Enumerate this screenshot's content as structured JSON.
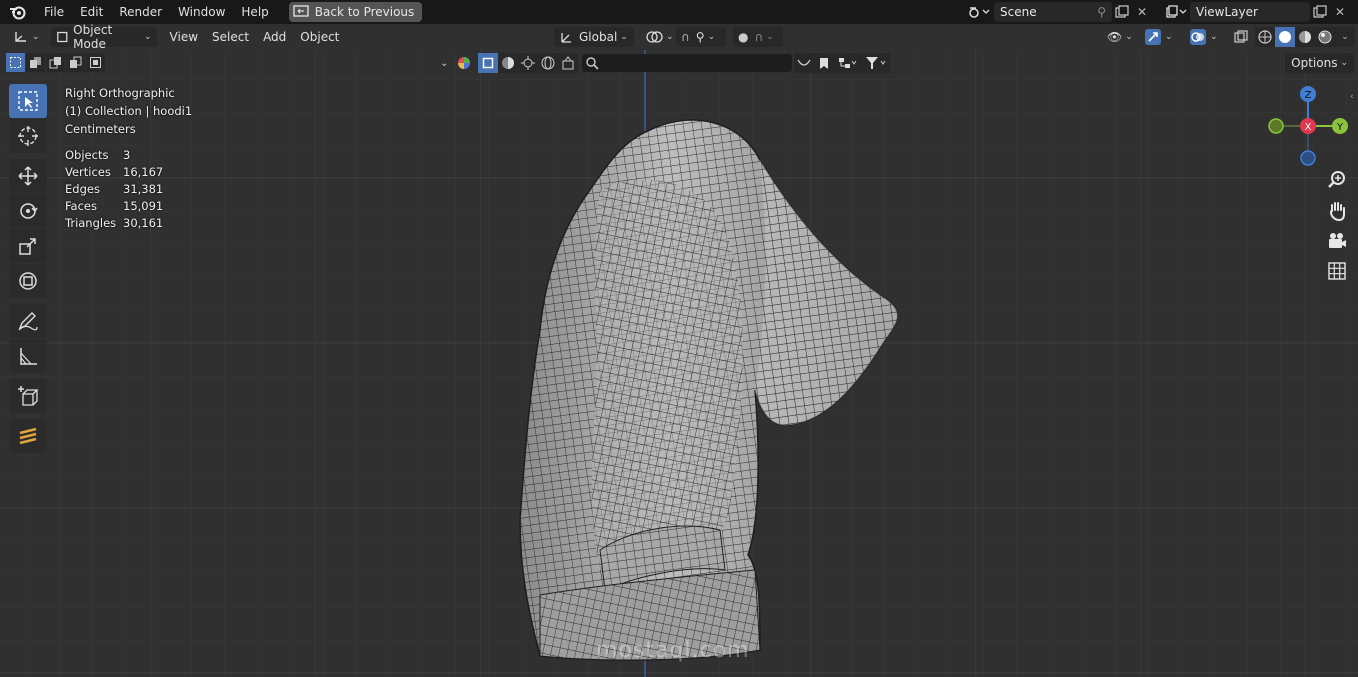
{
  "menubar": {
    "items": [
      "File",
      "Edit",
      "Render",
      "Window",
      "Help"
    ],
    "back_button": "Back to Previous",
    "scene_name": "Scene",
    "view_layer": "ViewLayer"
  },
  "header": {
    "mode": "Object Mode",
    "menus": [
      "View",
      "Select",
      "Add",
      "Object"
    ],
    "transform_orientation": "Global",
    "options_label": "Options"
  },
  "overlay": {
    "view_name": "Right Orthographic",
    "collection": "(1) Collection | hoodi1",
    "units": "Centimeters",
    "stats": [
      {
        "label": "Objects",
        "value": "3"
      },
      {
        "label": "Vertices",
        "value": "16,167"
      },
      {
        "label": "Edges",
        "value": "31,381"
      },
      {
        "label": "Faces",
        "value": "15,091"
      },
      {
        "label": "Triangles",
        "value": "30,161"
      }
    ]
  },
  "gizmo": {
    "z": "Z",
    "x": "X",
    "y": "Y",
    "colors": {
      "x": "#e0384f",
      "y": "#8bc43a",
      "z": "#3f7fd6"
    }
  },
  "watermark": "mostaql.com",
  "icons": {
    "toolbar": [
      "select-box-icon",
      "cursor-icon",
      "move-icon",
      "rotate-icon",
      "scale-icon",
      "transform-icon",
      "annotate-icon",
      "measure-icon",
      "add-cube-icon",
      "grease-pencil-icon"
    ],
    "nav": [
      "zoom-icon",
      "hand-pan-icon",
      "camera-icon",
      "grid-icon"
    ]
  },
  "colors": {
    "accent": "#4772b3",
    "background": "#303030",
    "topbar": "#181818"
  }
}
